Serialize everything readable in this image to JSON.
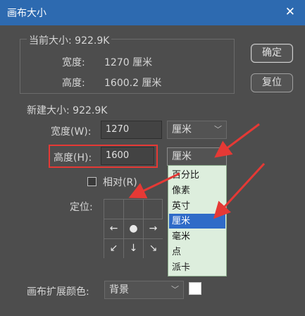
{
  "window": {
    "title": "画布大小",
    "close_glyph": "✕"
  },
  "current_size": {
    "label": "当前大小: 922.9K",
    "width_label": "宽度:",
    "width_value": "1270 厘米",
    "height_label": "高度:",
    "height_value": "1600.2 厘米"
  },
  "buttons": {
    "ok": "确定",
    "reset": "复位"
  },
  "new_size": {
    "label": "新建大小: 922.9K",
    "width_label": "宽度(W):",
    "width_value": "1270",
    "width_unit": "厘米",
    "height_label": "高度(H):",
    "height_value": "1600",
    "height_unit": "厘米",
    "relative_label": "相对(R)",
    "relative_checked": false
  },
  "anchor": {
    "label": "定位:",
    "cells": [
      "",
      "←",
      "●",
      "→",
      "↙",
      "↓",
      "↘"
    ]
  },
  "unit_dropdown": {
    "options": [
      "百分比",
      "像素",
      "英寸",
      "厘米",
      "毫米",
      "点",
      "派卡"
    ],
    "selected_index": 3
  },
  "extension": {
    "label": "画布扩展颜色:",
    "value": "背景",
    "swatch_color": "#ffffff"
  },
  "colors": {
    "titlebar": "#2d6ab0",
    "highlight": "#e53935",
    "dropdown_bg": "#ddeedd",
    "selected_bg": "#2f6bc8"
  }
}
